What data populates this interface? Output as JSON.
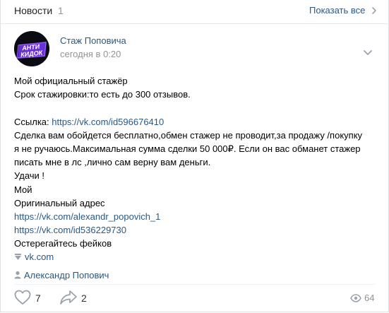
{
  "header": {
    "title": "Новости",
    "count": "1",
    "show_all": "Показать все"
  },
  "post": {
    "author": "Стаж Поповича",
    "time": "сегодня в 0:20",
    "avatar_text": "АНТИ КИДОК",
    "lines": {
      "l1": "Мой официальный стажёр",
      "l2": "Срок стажировки:то есть до 300 отзывов.",
      "l4_label": "Ссылка: ",
      "l4_link": "https://vk.com/id596676410",
      "l5": "Сделка вам обойдется бесплатно,обмен стажер не проводит,за продажу /покупку",
      "l6": "я не ручаюсь.Максимальная сумма сделки 50 000₽. Если он вас обманет стажер",
      "l7": "писать мне в лс ,лично сам верну вам деньги.",
      "l8": "Удачи !",
      "l9": "Мой",
      "l10": "Оригинальный адрес",
      "l11_link": "https://vk.com/alexandr_popovich_1",
      "l12_link": "https://vk.com/id536229730",
      "l13": "Остерегайтесь фейков"
    },
    "attachment_link": "vk.com",
    "signer": "Александр Попович",
    "likes": "7",
    "shares": "2",
    "views": "64"
  },
  "colors": {
    "link": "#2a5885",
    "muted": "#939393",
    "icon": "#99a2ad"
  }
}
